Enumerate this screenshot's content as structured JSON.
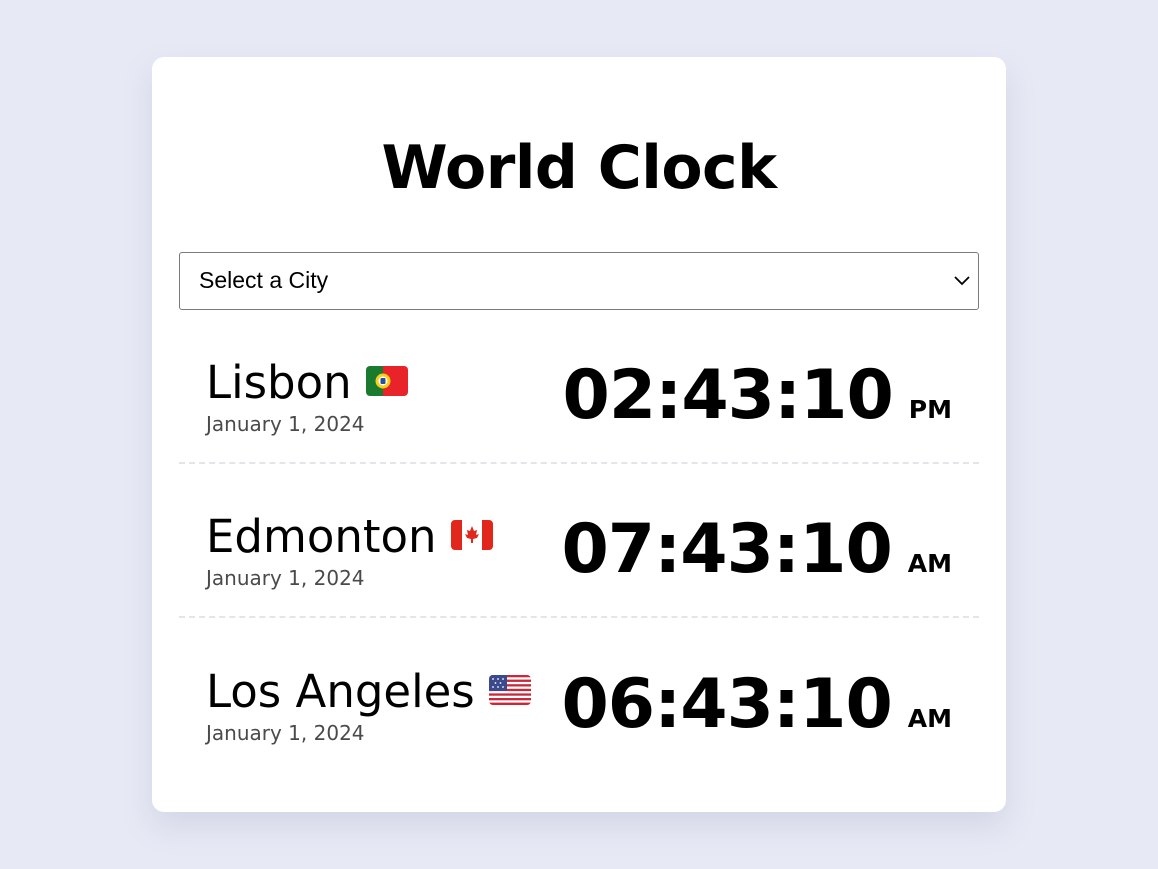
{
  "app": {
    "title": "World Clock"
  },
  "city_select": {
    "label": "Select a City",
    "icon": "chevron-down-icon"
  },
  "clocks": [
    {
      "city": "Lisbon",
      "flag_icon": "portugal-flag-icon",
      "date": "January 1, 2024",
      "time": "02:43:10",
      "period": "PM"
    },
    {
      "city": "Edmonton",
      "flag_icon": "canada-flag-icon",
      "date": "January 1, 2024",
      "time": "07:43:10",
      "period": "AM"
    },
    {
      "city": "Los Angeles",
      "flag_icon": "usa-flag-icon",
      "date": "January 1, 2024",
      "time": "06:43:10",
      "period": "AM"
    }
  ],
  "colors": {
    "background": "#e7e9f5",
    "card": "#ffffff",
    "text": "#000000",
    "date_text": "#4a4a4a",
    "divider": "#e3e5ea"
  }
}
